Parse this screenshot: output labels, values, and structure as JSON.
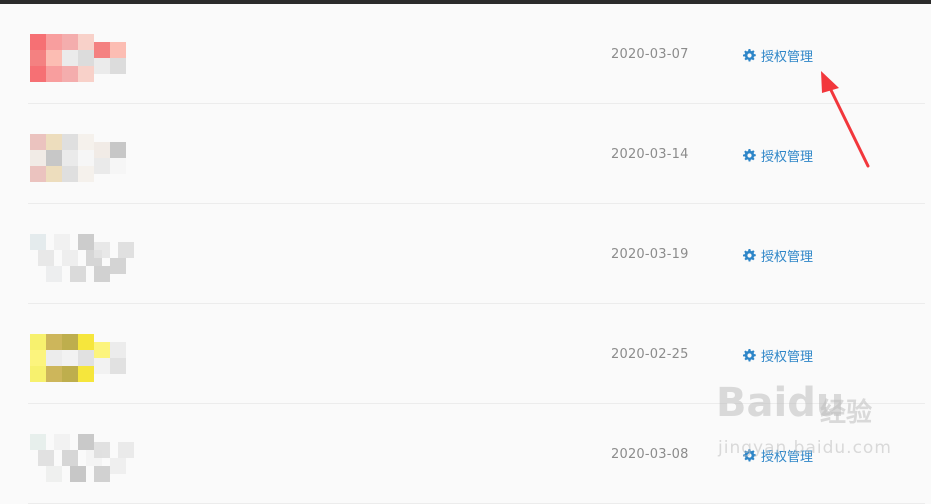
{
  "list": {
    "rows": [
      {
        "date": "2020-03-07",
        "action_label": "授权管理",
        "thumb_palette": [
          "#f4575c",
          "#f78d8d",
          "#f29f9f",
          "#f7c9c0",
          "#f26b6b",
          "#fbb2a6",
          "#e8e8e8",
          "#d6d6d6"
        ]
      },
      {
        "date": "2020-03-14",
        "action_label": "授权管理",
        "thumb_palette": [
          "#e7b9b4",
          "#ead7b2",
          "#d9d9d9",
          "#f3efe9",
          "#efe8e2",
          "#bdbdbd",
          "#e6e6e6",
          "#f5f5f5"
        ]
      },
      {
        "date": "2020-03-19",
        "action_label": "授权管理",
        "thumb_palette": [
          "#dfe8ea",
          "#eeeeee",
          "#d4d4d4",
          "#c9c9c9",
          "#e4e4e4",
          "#dadada",
          "#f0f0f0",
          "#cfcfcf"
        ]
      },
      {
        "date": "2020-02-25",
        "action_label": "授权管理",
        "thumb_palette": [
          "#f6ee55",
          "#c4a93e",
          "#b3a02e",
          "#f5e21a",
          "#fbf266",
          "#e9e9e9",
          "#f0f0f0",
          "#dcdcdc"
        ]
      },
      {
        "date": "2020-03-08",
        "action_label": "授权管理",
        "thumb_palette": [
          "#e3ece9",
          "#f0f0f0",
          "#bdbdbd",
          "#c9c9c9",
          "#dcdcdc",
          "#e6e6e6",
          "#d2d2d2",
          "#f2f2f2"
        ]
      }
    ]
  },
  "annotation": {
    "arrow_color": "#f2373c"
  },
  "watermark": {
    "brand": "Bai",
    "brand2": "du",
    "cn": "经验",
    "url": "jingyan.baidu.com"
  },
  "colors": {
    "accent": "#2e86c8",
    "date_text": "#8c8c8c",
    "divider": "#ececec"
  }
}
